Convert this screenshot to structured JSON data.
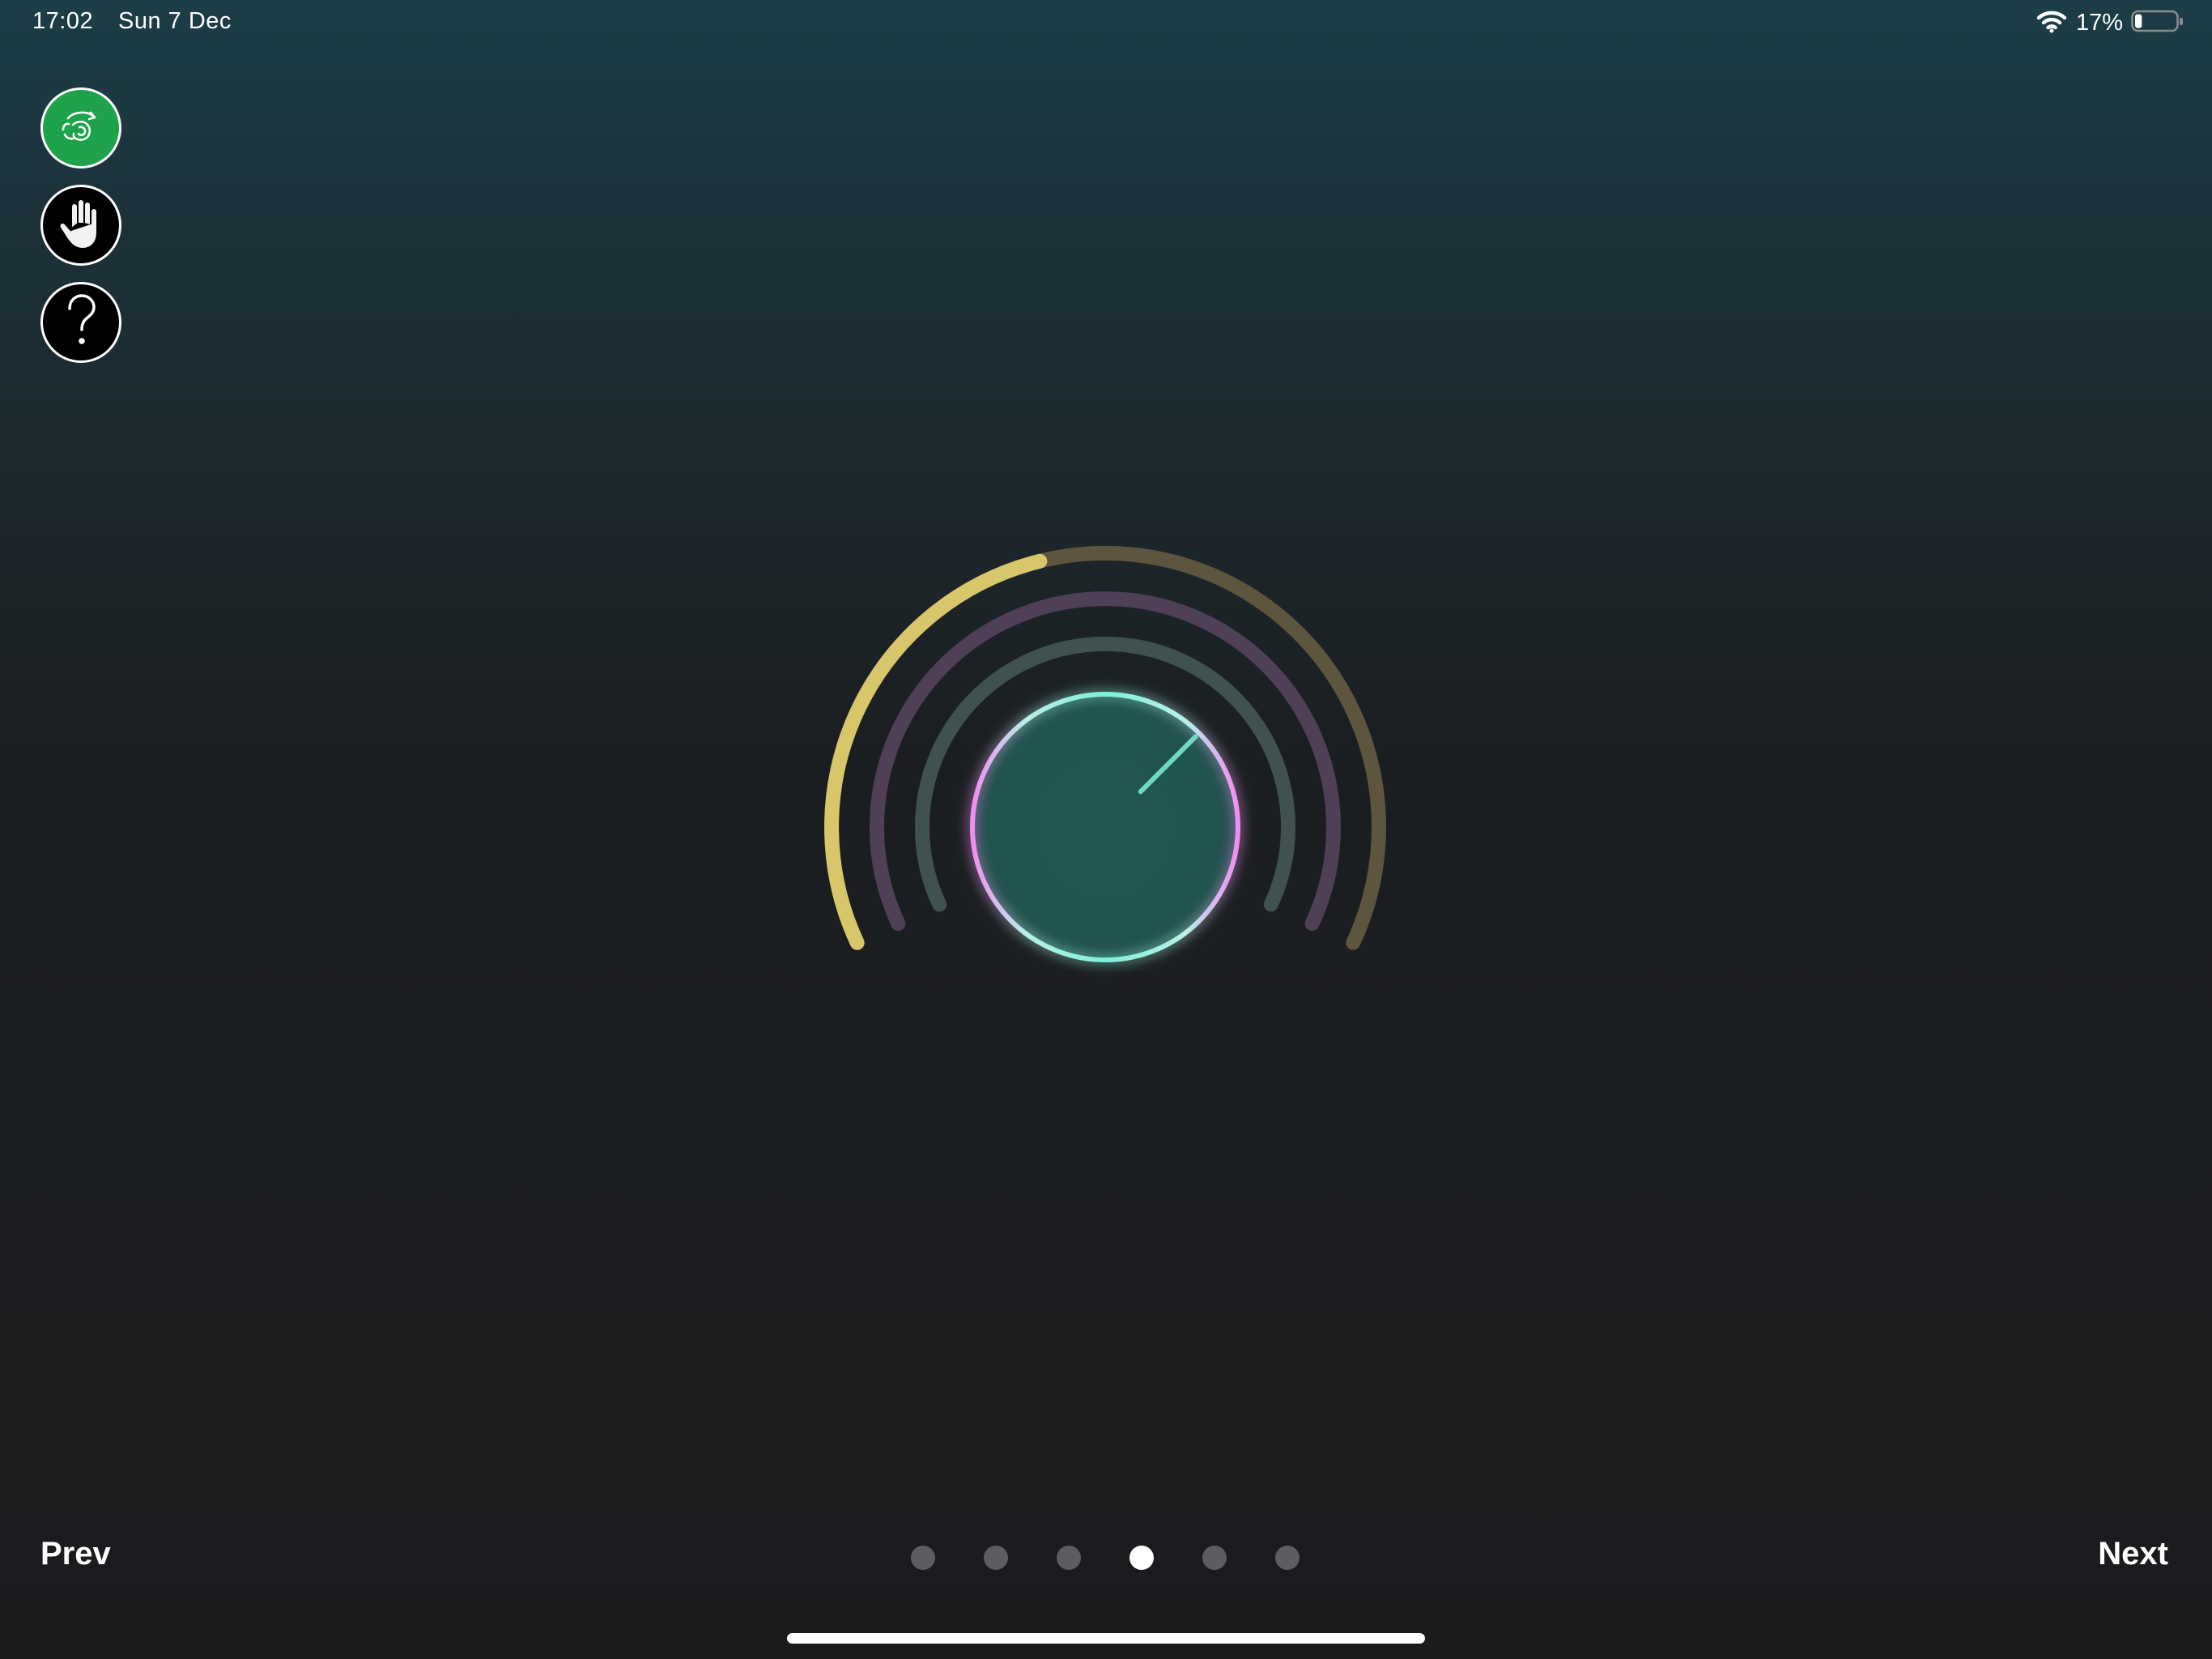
{
  "status_bar": {
    "time": "17:02",
    "date": "Sun 7 Dec",
    "battery_percent": "17%",
    "battery_level": 0.17,
    "icons": [
      "wifi-icon",
      "battery-icon"
    ]
  },
  "toolbar": {
    "buttons": [
      {
        "name": "gesture-button",
        "icon": "rotate-gesture-icon",
        "color": "#1fa34a"
      },
      {
        "name": "hand-button",
        "icon": "hand-icon",
        "color": "#000000"
      },
      {
        "name": "help-button",
        "icon": "question-mark-icon",
        "color": "#000000"
      }
    ]
  },
  "knob": {
    "arcs": [
      {
        "name": "outer-arc",
        "color": "#d8c66a",
        "track_color": "#5e553f",
        "fill_fraction": 0.44
      },
      {
        "name": "middle-arc",
        "color": "#4f3f57",
        "fill_fraction": 1.0
      },
      {
        "name": "inner-arc",
        "color": "#3f524f",
        "fill_fraction": 1.0
      }
    ],
    "dial_fill_color": "#215450",
    "ring_colors": [
      "#7ef0d8",
      "#f08ef0"
    ],
    "indicator_color": "#6fd8c4",
    "indicator_angle_deg": 45
  },
  "navigation": {
    "prev_label": "Prev",
    "next_label": "Next",
    "page_count": 6,
    "current_page": 4
  }
}
